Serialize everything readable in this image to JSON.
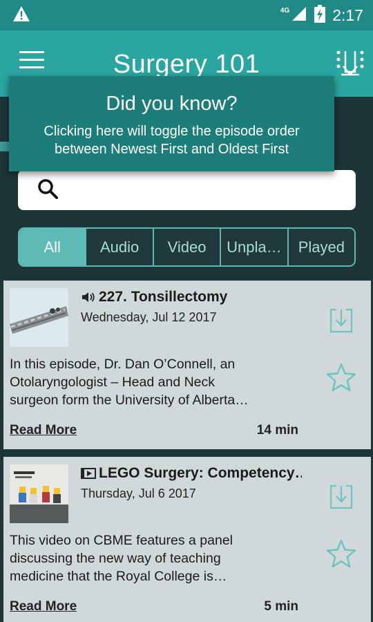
{
  "status_bar": {
    "network": "4G",
    "time": "2:17",
    "icons": [
      "alert-icon",
      "signal-icon",
      "battery-icon"
    ]
  },
  "app_bar": {
    "title": "Surgery 101",
    "icons": [
      "menu-icon",
      "sort-order-icon"
    ]
  },
  "tooltip": {
    "title": "Did you know?",
    "body_line1": "Clicking here will toggle the episode order",
    "body_line2": "between Newest First and Oldest First"
  },
  "search": {
    "placeholder": "",
    "value": "",
    "icon": "search-icon"
  },
  "filter_tabs": [
    {
      "label": "All",
      "active": true
    },
    {
      "label": "Audio",
      "active": false
    },
    {
      "label": "Video",
      "active": false
    },
    {
      "label": "Unpla…",
      "active": false
    },
    {
      "label": "Played",
      "active": false
    }
  ],
  "episodes": [
    {
      "media_type": "audio",
      "title": "227. Tonsillectomy",
      "date": "Wednesday, Jul 12 2017",
      "description_line1": "In this episode, Dr. Dan O’Connell, an",
      "description_line2": "Otolaryngologist – Head and Neck",
      "description_line3": "surgeon form the University of Alberta…",
      "read_more": "Read More",
      "duration": "14 min"
    },
    {
      "media_type": "video",
      "title": "LEGO Surgery: Competency…",
      "date": "Thursday, Jul 6 2017",
      "description_line1": "This video on CBME features a panel",
      "description_line2": "discussing the new way of teaching",
      "description_line3": "medicine that the Royal College is…",
      "read_more": "Read More",
      "duration": "5 min"
    }
  ],
  "colors": {
    "status_bar": "#1f8a86",
    "app_bar": "#2aa6a1",
    "tooltip": "#1d7e79",
    "accent": "#5dbab5",
    "card": "#d0d8d9",
    "icon_teal": "#6cc4bf"
  }
}
